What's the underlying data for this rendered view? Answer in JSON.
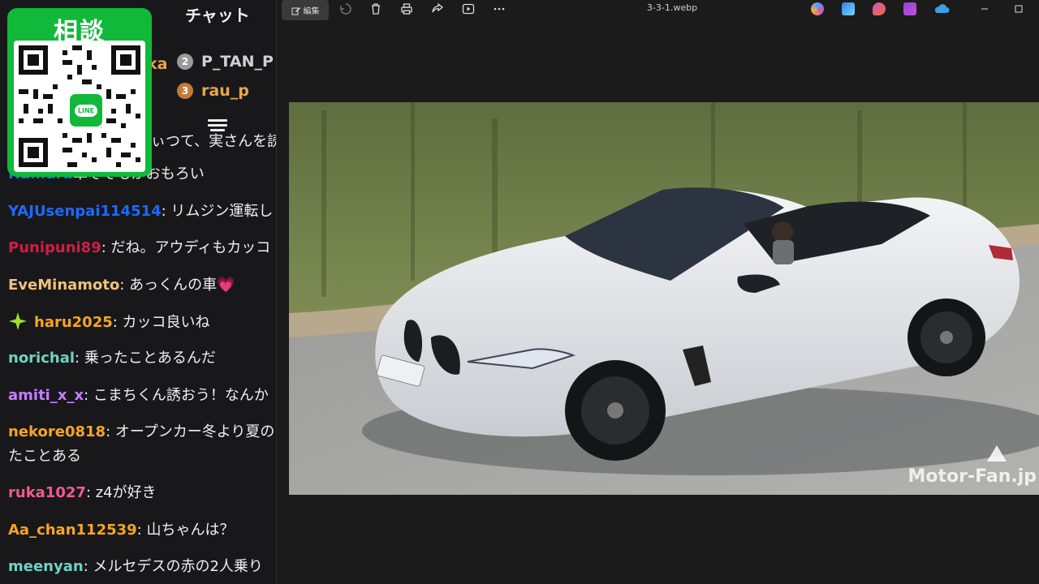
{
  "chat": {
    "title": "チャット",
    "leaders": [
      {
        "rank": "2",
        "name": "P_TAN_P",
        "color": "#d0d0d0",
        "badge_color": "#9a9a9a"
      },
      {
        "rank": "3",
        "name": "rau_p",
        "color": "#e8a74a",
        "badge_color": "#c47a3a"
      }
    ],
    "leader_partial": "ka",
    "partial_line": "ぃつて、実さんを読",
    "messages": [
      {
        "user": "Hamura",
        "text": "車そそもがおもろい",
        "color": "#1e69ff"
      },
      {
        "user": "YAJUsenpai114514",
        "text": ": リムジン運転し",
        "color": "#1e69ff"
      },
      {
        "user": "Punipuni89",
        "text": ": だね。アウディもカッコ",
        "color": "#d11c49"
      },
      {
        "user": "EveMinamoto",
        "text": ": あっくんの車",
        "color": "#f0c27a",
        "emoji": "💗"
      },
      {
        "user": "haru2025",
        "text": ": カッコ良いね",
        "color": "#f5a623",
        "star": true
      },
      {
        "user": "norichal",
        "text": ": 乗ったことあるんだ",
        "color": "#6fd3c0"
      },
      {
        "user": "amiti_x_x",
        "text": ": こまちくん誘おう！なんか",
        "color": "#c57dff"
      },
      {
        "user": "nekore0818",
        "text": ": オープンカー冬より夏の",
        "color": "#f5a623",
        "wrap": "たことある"
      },
      {
        "user": "ruka1027",
        "text": ": z4が好き",
        "color": "#ef5b8e"
      },
      {
        "user": "Aa_chan112539",
        "text": ": 山ちゃんは？",
        "color": "#f5a623"
      },
      {
        "user": "meenyan",
        "text": ": メルセデスの赤の2人乗り",
        "color": "#6fd3c0"
      }
    ]
  },
  "promo": {
    "title": "相談",
    "logo_text": "LINE"
  },
  "viewer": {
    "edit_label": "編集",
    "filename": "3-3-1.webp",
    "watermark": "Motor-Fan.jp",
    "toolbar_icons": [
      "rotate-icon",
      "delete-icon",
      "print-icon",
      "share-icon",
      "slideshow-icon",
      "more-icon"
    ],
    "app_icons": [
      {
        "name": "copilot-icon",
        "color": "#4ea1ff"
      },
      {
        "name": "photos-editor-icon",
        "color": "#2c86e6"
      },
      {
        "name": "designer-icon",
        "color": "#d254b8"
      },
      {
        "name": "clipchamp-icon",
        "color": "#8b4bd8"
      },
      {
        "name": "onedrive-icon",
        "color": "#3c9fe8"
      }
    ]
  }
}
